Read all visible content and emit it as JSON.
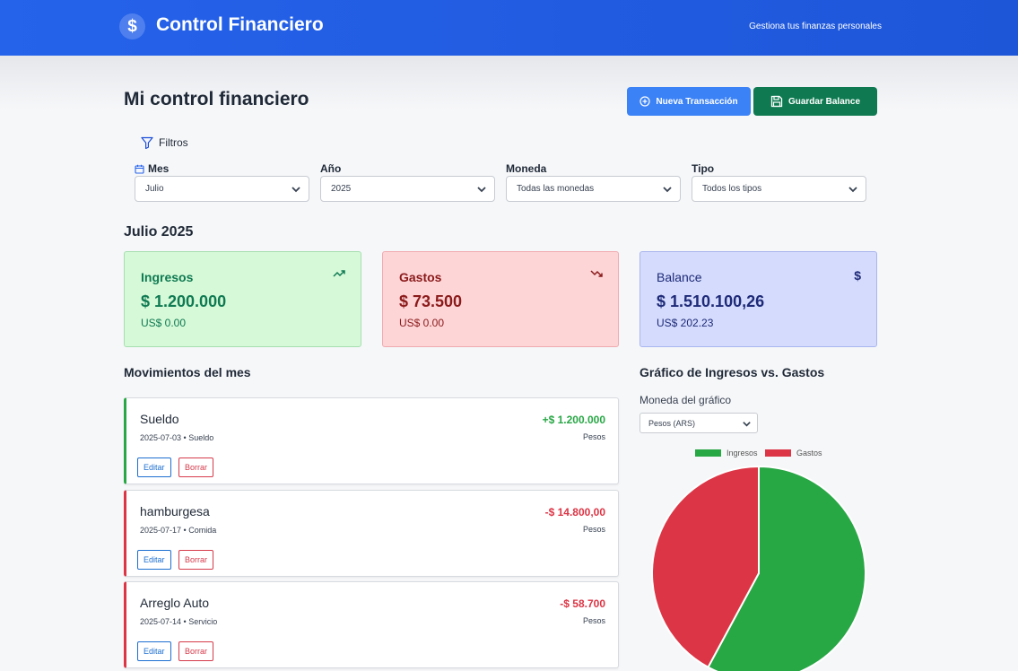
{
  "header": {
    "title": "Control Financiero",
    "tagline": "Gestiona tus finanzas personales",
    "icon": "dollar-icon"
  },
  "page": {
    "title": "Mi control financiero"
  },
  "actions": {
    "new_transaction": "Nueva Transacción",
    "save_balance": "Guardar Balance"
  },
  "filters": {
    "heading": "Filtros",
    "month": {
      "label": "Mes",
      "value": "Julio"
    },
    "year": {
      "label": "Año",
      "value": "2025"
    },
    "currency": {
      "label": "Moneda",
      "value": "Todas las monedas"
    },
    "type": {
      "label": "Tipo",
      "value": "Todos los tipos"
    }
  },
  "period": "Julio 2025",
  "summary": {
    "income": {
      "title": "Ingresos",
      "amount": "$ 1.200.000",
      "usd": "US$ 0.00",
      "color": "#0f7a52",
      "icon": "trending-up-icon"
    },
    "expenses": {
      "title": "Gastos",
      "amount": "$ 73.500",
      "usd": "US$ 0.00",
      "color": "#8b1a1a",
      "icon": "trending-down-icon"
    },
    "balance": {
      "title": "Balance",
      "amount": "$ 1.510.100,26",
      "usd": "US$ 202.23",
      "color": "#1e2a78",
      "icon": "dollar-icon"
    }
  },
  "movements": {
    "title": "Movimientos del mes",
    "edit_label": "Editar",
    "delete_label": "Borrar",
    "items": [
      {
        "name": "Sueldo",
        "meta": "2025-07-03 • Sueldo",
        "amount": "+$ 1.200.000",
        "currency": "Pesos",
        "kind": "income"
      },
      {
        "name": "hamburgesa",
        "meta": "2025-07-17 • Comida",
        "amount": "-$ 14.800,00",
        "currency": "Pesos",
        "kind": "expense"
      },
      {
        "name": "Arreglo Auto",
        "meta": "2025-07-14 • Servicio",
        "amount": "-$ 58.700",
        "currency": "Pesos",
        "kind": "expense"
      }
    ]
  },
  "chart": {
    "title": "Gráfico de Ingresos vs. Gastos",
    "currency_label": "Moneda del gráfico",
    "currency_value": "Pesos (ARS)"
  },
  "chart_data": {
    "type": "pie",
    "categories": [
      "Ingresos",
      "Gastos"
    ],
    "values": [
      1200000,
      873500
    ],
    "colors": [
      "#28a745",
      "#dc3545"
    ],
    "legend": "top"
  }
}
